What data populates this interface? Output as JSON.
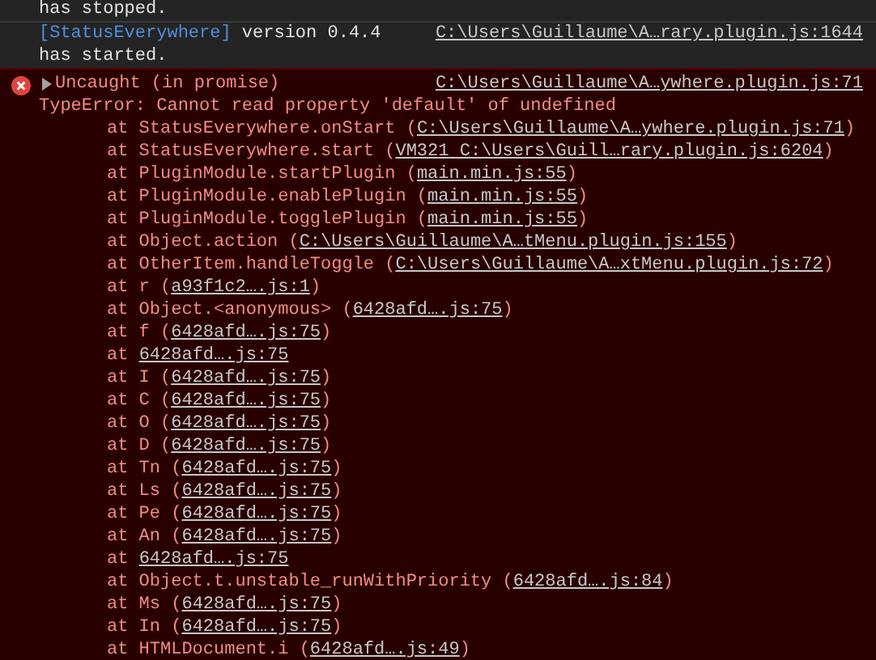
{
  "console": {
    "messages": [
      {
        "kind": "log",
        "lines": [
          {
            "text": "has stopped."
          }
        ]
      },
      {
        "kind": "log",
        "prefix": "[StatusEverywhere]",
        "text": "version 0.4.4",
        "source": "C:\\Users\\Guillaume\\A…rary.plugin.js:1644",
        "lines": [
          {
            "text": "has started."
          }
        ]
      },
      {
        "kind": "error",
        "expanded": false,
        "summary": "Uncaught (in promise)",
        "source": "C:\\Users\\Guillaume\\A…ywhere.plugin.js:71",
        "message": "TypeError: Cannot read property 'default' of undefined",
        "frames": [
          {
            "call": "at StatusEverywhere.onStart (",
            "location": "C:\\Users\\Guillaume\\A…ywhere.plugin.js:71",
            "close": ")"
          },
          {
            "call": "at StatusEverywhere.start (",
            "location": "VM321 C:\\Users\\Guill…rary.plugin.js:6204",
            "close": ")"
          },
          {
            "call": "at PluginModule.startPlugin (",
            "location": "main.min.js:55",
            "close": ")"
          },
          {
            "call": "at PluginModule.enablePlugin (",
            "location": "main.min.js:55",
            "close": ")"
          },
          {
            "call": "at PluginModule.togglePlugin (",
            "location": "main.min.js:55",
            "close": ")"
          },
          {
            "call": "at Object.action (",
            "location": "C:\\Users\\Guillaume\\A…tMenu.plugin.js:155",
            "close": ")"
          },
          {
            "call": "at OtherItem.handleToggle (",
            "location": "C:\\Users\\Guillaume\\A…xtMenu.plugin.js:72",
            "close": ")"
          },
          {
            "call": "at r (",
            "location": "a93f1c2….js:1",
            "close": ")"
          },
          {
            "call": "at Object.<anonymous> (",
            "location": "6428afd….js:75",
            "close": ")"
          },
          {
            "call": "at f (",
            "location": "6428afd….js:75",
            "close": ")"
          },
          {
            "call": "at",
            "location": "6428afd….js:75"
          },
          {
            "call": "at I (",
            "location": "6428afd….js:75",
            "close": ")"
          },
          {
            "call": "at C (",
            "location": "6428afd….js:75",
            "close": ")"
          },
          {
            "call": "at O (",
            "location": "6428afd….js:75",
            "close": ")"
          },
          {
            "call": "at D (",
            "location": "6428afd….js:75",
            "close": ")"
          },
          {
            "call": "at Tn (",
            "location": "6428afd….js:75",
            "close": ")"
          },
          {
            "call": "at Ls (",
            "location": "6428afd….js:75",
            "close": ")"
          },
          {
            "call": "at Pe (",
            "location": "6428afd….js:75",
            "close": ")"
          },
          {
            "call": "at An (",
            "location": "6428afd….js:75",
            "close": ")"
          },
          {
            "call": "at",
            "location": "6428afd….js:75"
          },
          {
            "call": "at Object.t.unstable_runWithPriority (",
            "location": "6428afd….js:84",
            "close": ")"
          },
          {
            "call": "at Ms (",
            "location": "6428afd….js:75",
            "close": ")"
          },
          {
            "call": "at In (",
            "location": "6428afd….js:75",
            "close": ")"
          },
          {
            "call": "at HTMLDocument.i (",
            "location": "6428afd….js:49",
            "close": ")"
          }
        ]
      }
    ]
  }
}
